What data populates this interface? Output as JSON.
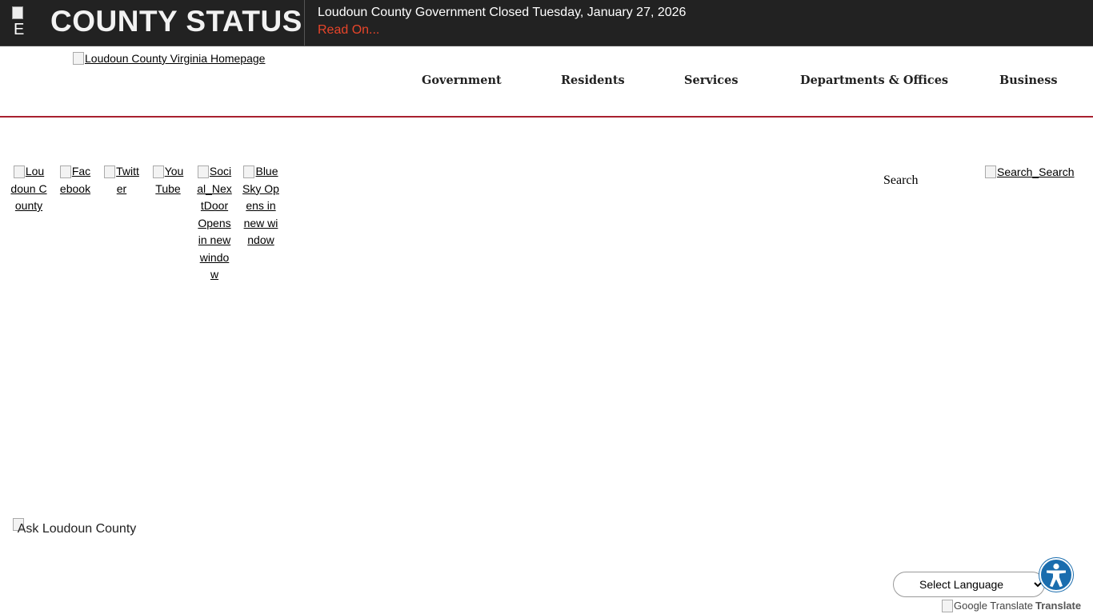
{
  "alert": {
    "icon_alt": "E",
    "heading": "COUNTY STATUS",
    "message": "Loudoun County Government Closed Tuesday, January 27, 2026",
    "read_on": "Read On..."
  },
  "header": {
    "logo_alt": "Loudoun County Virginia Homepage",
    "nav": [
      {
        "label": "Government"
      },
      {
        "label": "Residents"
      },
      {
        "label": "Services"
      },
      {
        "label": "Departments & Offices"
      },
      {
        "label": "Business"
      }
    ]
  },
  "social": [
    {
      "label": "Loudoun County"
    },
    {
      "label": "Facebook"
    },
    {
      "label": "Twitter"
    },
    {
      "label": "YouTube"
    },
    {
      "label": "Social_NextDoor Opens in new window"
    },
    {
      "label": "BlueSky Opens in new window"
    }
  ],
  "search": {
    "label": "Search",
    "button_alt": "Search_Search"
  },
  "ask": {
    "label": "Ask Loudoun County"
  },
  "translate": {
    "select_value": "Select Language",
    "google_alt": "Google Translate",
    "translate_word": "Translate"
  },
  "colors": {
    "alert_background": "#222222",
    "alert_link": "#e8452a",
    "header_rule": "#a8202f",
    "accessibility": "#1a6dae"
  },
  "icons": {
    "accessibility": "accessibility-person-icon"
  }
}
